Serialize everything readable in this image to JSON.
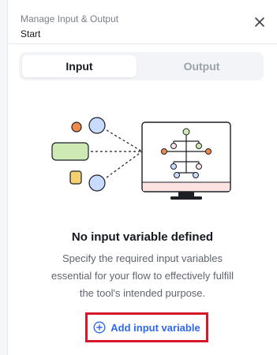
{
  "header": {
    "subtitle": "Manage Input & Output",
    "title": "Start"
  },
  "tabs": [
    {
      "label": "Input",
      "active": true
    },
    {
      "label": "Output",
      "active": false
    }
  ],
  "empty_state": {
    "title": "No input variable defined",
    "description": "Specify the required input variables essential for your flow to effectively fulfill the tool's intended purpose."
  },
  "actions": {
    "add_label": "Add input variable"
  },
  "colors": {
    "accent": "#2f67f0",
    "highlight_border": "#d7172a",
    "orange": "#f08a4b",
    "blue": "#c8dcff",
    "green": "#cfe9b5",
    "yellow": "#f6d06f",
    "pink": "#fde2e2"
  },
  "icons": {
    "close": "close-icon",
    "add": "plus-circle-icon"
  }
}
